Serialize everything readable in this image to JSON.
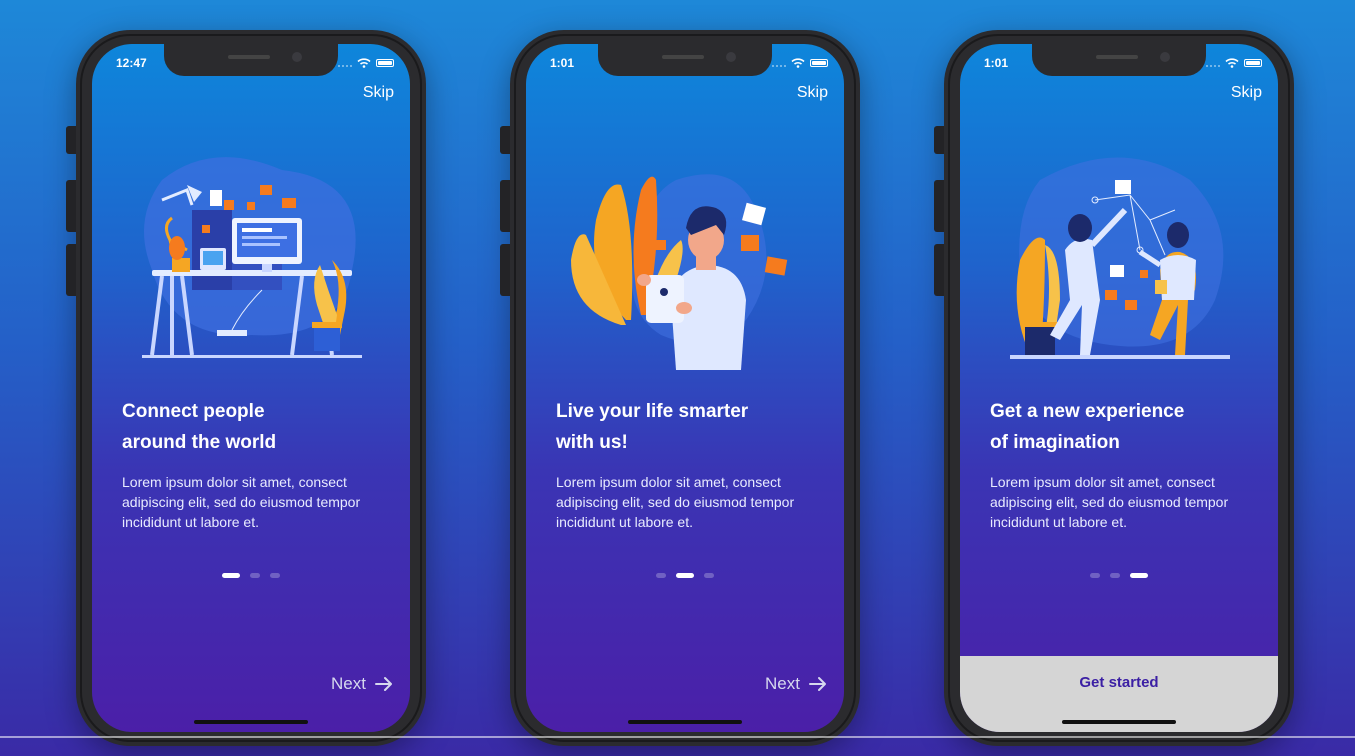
{
  "colors": {
    "background": "#2460c8",
    "screen_top": "#0e86db",
    "screen_bottom": "#4b1fa8",
    "accent_orange": "#f5a623",
    "cta_bg": "#d5d5d5",
    "cta_text": "#3b1fa4"
  },
  "icons": {
    "status": [
      "signal-icon",
      "wifi-icon",
      "battery-icon"
    ],
    "next": "arrow-right-icon"
  },
  "screens": [
    {
      "time": "12:47",
      "skip": "Skip",
      "title_line1": "Connect people",
      "title_line2": "around the world",
      "desc_line1": "Lorem ipsum dolor sit amet, consect",
      "desc_line2": "adipiscing elit, sed do eiusmod tempor",
      "desc_line3": "incididunt ut labore et.",
      "page_index": 0,
      "page_count": 3,
      "next": "Next"
    },
    {
      "time": "1:01",
      "skip": "Skip",
      "title_line1": "Live your life smarter",
      "title_line2": "with us!",
      "desc_line1": "Lorem ipsum dolor sit amet, consect",
      "desc_line2": "adipiscing elit, sed do eiusmod tempor",
      "desc_line3": "incididunt ut labore et.",
      "page_index": 1,
      "page_count": 3,
      "next": "Next"
    },
    {
      "time": "1:01",
      "skip": "Skip",
      "title_line1": "Get a new experience",
      "title_line2": "of imagination",
      "desc_line1": "Lorem ipsum dolor sit amet, consect",
      "desc_line2": "adipiscing elit, sed do eiusmod tempor",
      "desc_line3": "incididunt ut labore et.",
      "page_index": 2,
      "page_count": 3,
      "cta": "Get started"
    }
  ]
}
